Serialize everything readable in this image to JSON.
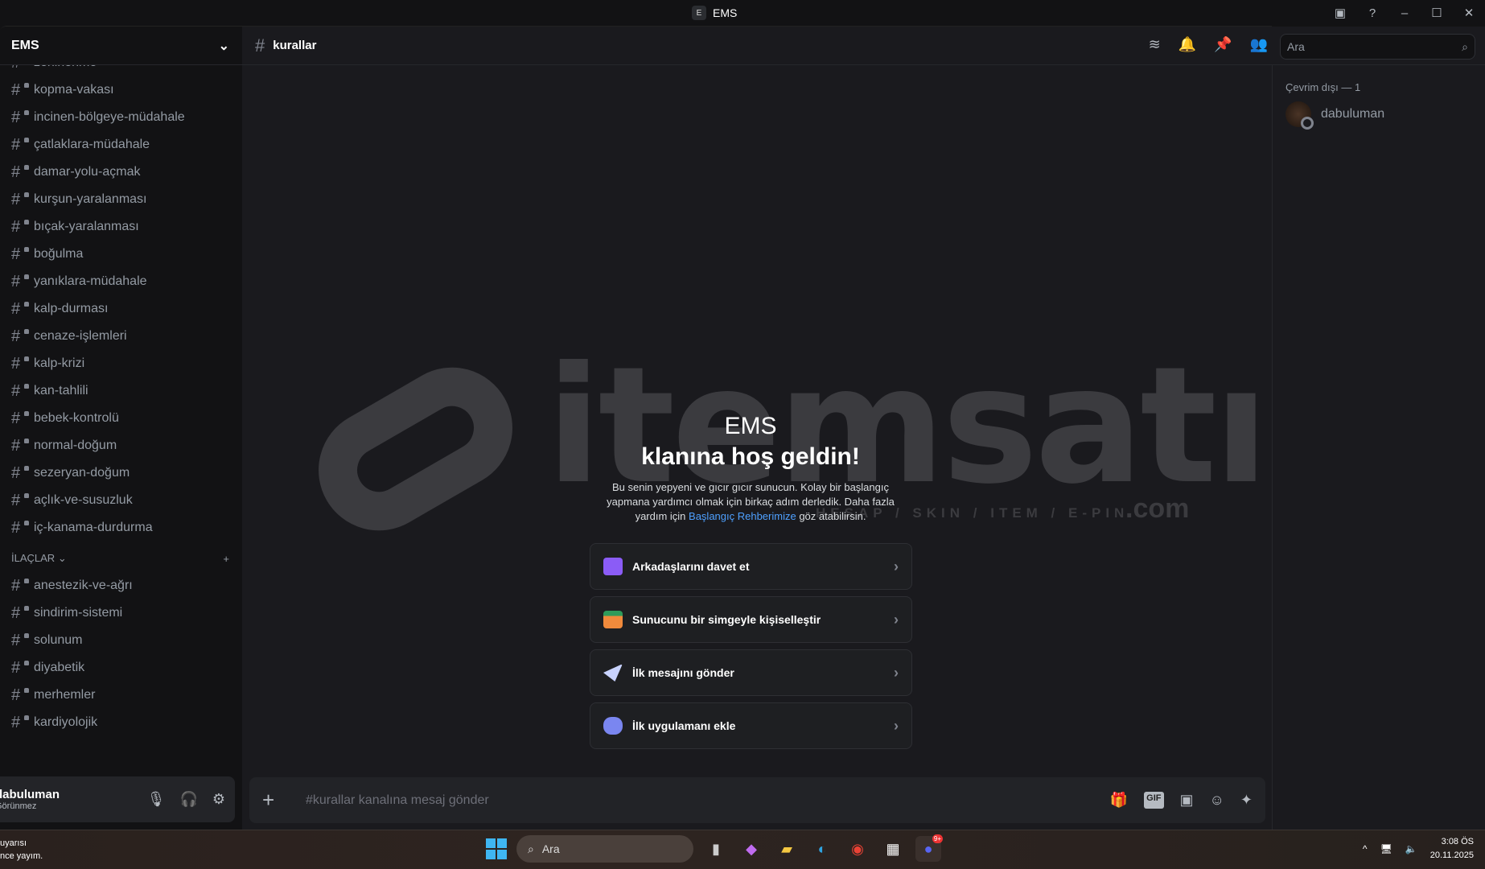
{
  "window": {
    "title": "EMS",
    "app_icon": "E"
  },
  "server": {
    "name": "EMS"
  },
  "channels_top": [
    "zehirlenme",
    "kopma-vakası",
    "incinen-bölgeye-müdahale",
    "çatlaklara-müdahale",
    "damar-yolu-açmak",
    "kurşun-yaralanması",
    "bıçak-yaralanması",
    "boğulma",
    "yanıklara-müdahale",
    "kalp-durması",
    "cenaze-işlemleri",
    "kalp-krizi",
    "kan-tahlili",
    "bebek-kontrolü",
    "normal-doğum",
    "sezeryan-doğum",
    "açlık-ve-susuzluk",
    "iç-kanama-durdurma"
  ],
  "category": {
    "name": "İLAÇLAR",
    "channels": [
      "anestezik-ve-ağrı",
      "sindirim-sistemi",
      "solunum",
      "diyabetik",
      "merhemler",
      "kardiyolojik"
    ]
  },
  "user": {
    "name": "dabuluman",
    "status": "Görünmez"
  },
  "channel": {
    "name": "kurallar",
    "search_placeholder": "Ara",
    "composer_placeholder": "#kurallar kanalına mesaj gönder"
  },
  "welcome": {
    "server": "EMS",
    "title": "klanına hoş geldin!",
    "text_before": "Bu senin yepyeni ve gıcır gıcır sunucun. Kolay bir başlangıç yapmana yardımcı olmak için birkaç adım derledik. Daha fazla yardım için ",
    "link": "Başlangıç Rehberimize",
    "text_after": " göz atabilirsin."
  },
  "cards": [
    "Arkadaşlarını davet et",
    "Sunucunu bir simgeyle kişiselleştir",
    "İlk mesajını gönder",
    "İlk uygulamanı ekle"
  ],
  "members": {
    "group": "Çevrim dışı — 1",
    "list": [
      "dabuluman"
    ]
  },
  "watermark": {
    "brand": "itemsatış",
    "tagline": "HESAP / SKIN / ITEM / E-PIN",
    "tld": ".com"
  },
  "taskbar": {
    "notif_line1": "uyarısı",
    "notif_line2": "nce yayım.",
    "search": "Ara",
    "badge": "9+",
    "time": "3:08 ÖS",
    "date": "20.11.2025"
  },
  "colors": {
    "link": "#4ea0ff",
    "bg": "#1a1a1e"
  }
}
